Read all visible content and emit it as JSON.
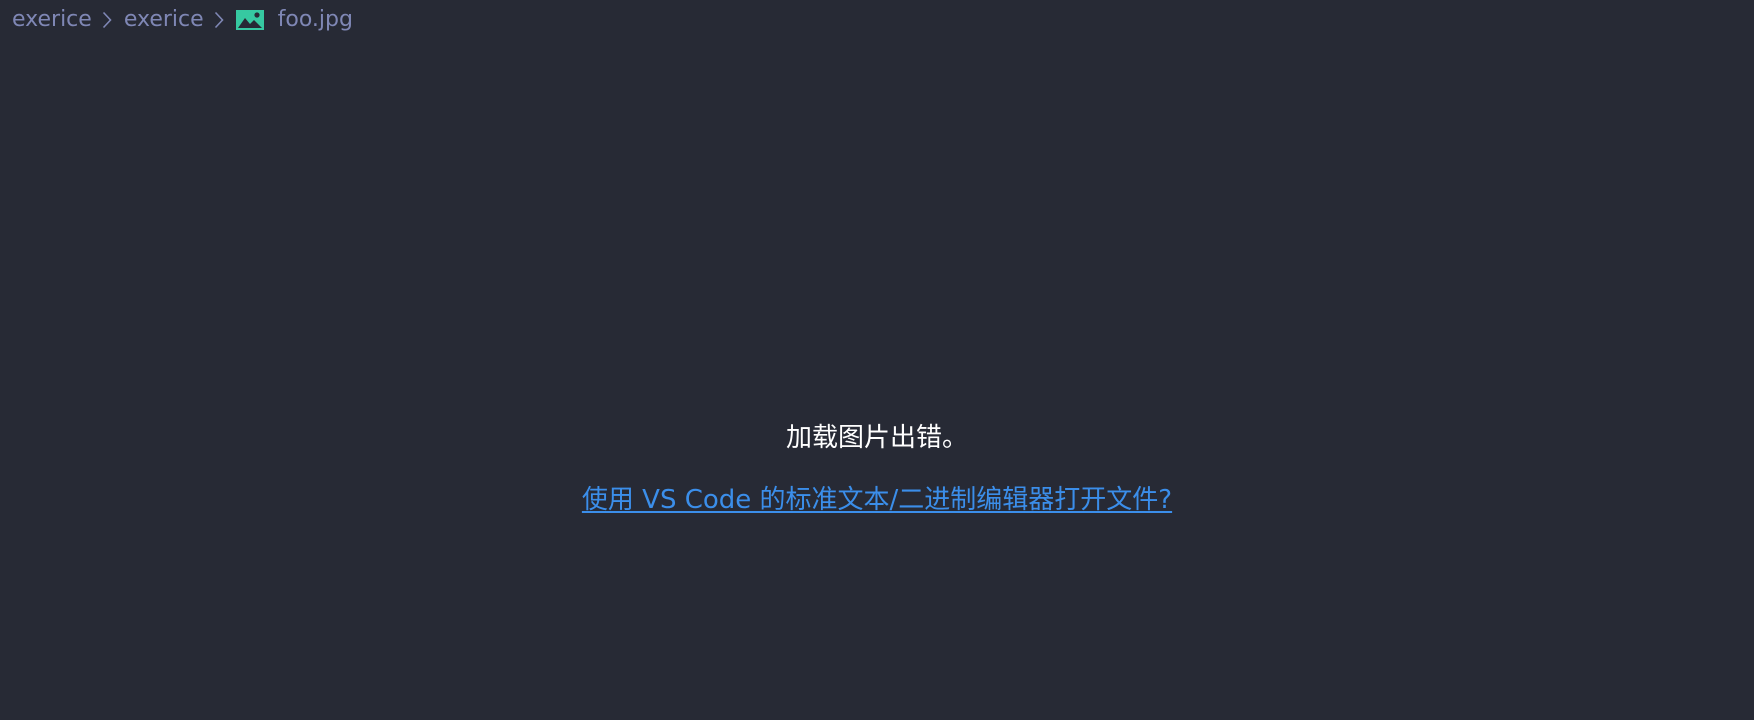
{
  "breadcrumb": {
    "items": [
      {
        "label": "exerice"
      },
      {
        "label": "exerice"
      },
      {
        "label": "foo.jpg",
        "icon": "image-file-icon"
      }
    ]
  },
  "viewer": {
    "error_message": "加载图片出错。",
    "open_link_label": "使用 VS Code 的标准文本/二进制编辑器打开文件?"
  },
  "colors": {
    "background": "#272a35",
    "breadcrumb_text": "#7f87b5",
    "image_icon": "#36c9a1",
    "error_text": "#ffffff",
    "link": "#3b8eea"
  }
}
